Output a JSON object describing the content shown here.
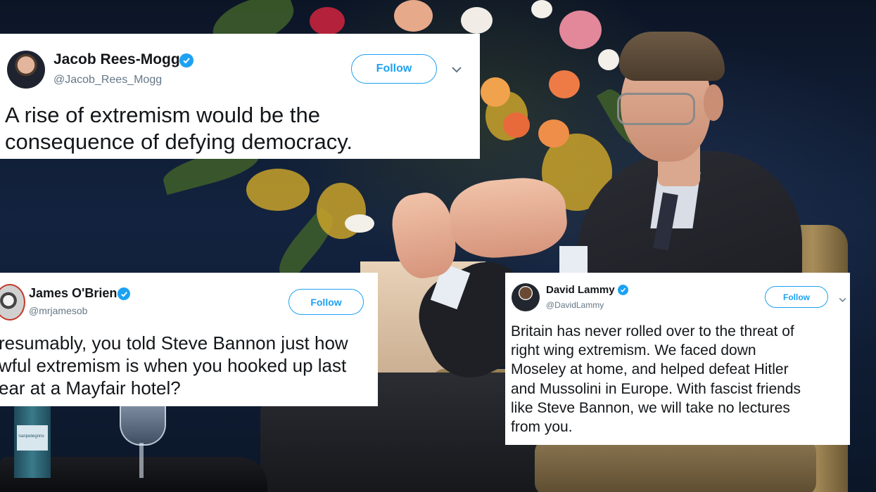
{
  "tweets": [
    {
      "name": "Jacob Rees-Mogg",
      "handle": "@Jacob_Rees_Mogg",
      "follow_label": "Follow",
      "text_lines": [
        "A rise of extremism would be the",
        "consequence of defying democracy."
      ]
    },
    {
      "name": "James O'Brien",
      "handle": "@mrjamesob",
      "follow_label": "Follow",
      "text_lines": [
        "resumably, you told Steve Bannon just how",
        "wful extremism is when you hooked up last",
        "ear at a Mayfair hotel?"
      ]
    },
    {
      "name": "David Lammy",
      "handle": "@DavidLammy",
      "follow_label": "Follow",
      "text_lines": [
        "Britain has never rolled over to the threat of",
        "right wing extremism. We faced down",
        "Moseley at home, and helped defeat Hitler",
        "and Mussolini in Europe. With fascist friends",
        "like Steve Bannon, we will take no lectures",
        "from you."
      ]
    }
  ],
  "bottle_label": "Sanpellegrino",
  "colors": {
    "twitter_blue": "#1da1f2",
    "handle_grey": "#657786",
    "text_dark": "#14171a",
    "card_bg": "#ffffff"
  },
  "icons": {
    "verified": "verified-badge-icon",
    "chevron": "chevron-down-icon"
  }
}
